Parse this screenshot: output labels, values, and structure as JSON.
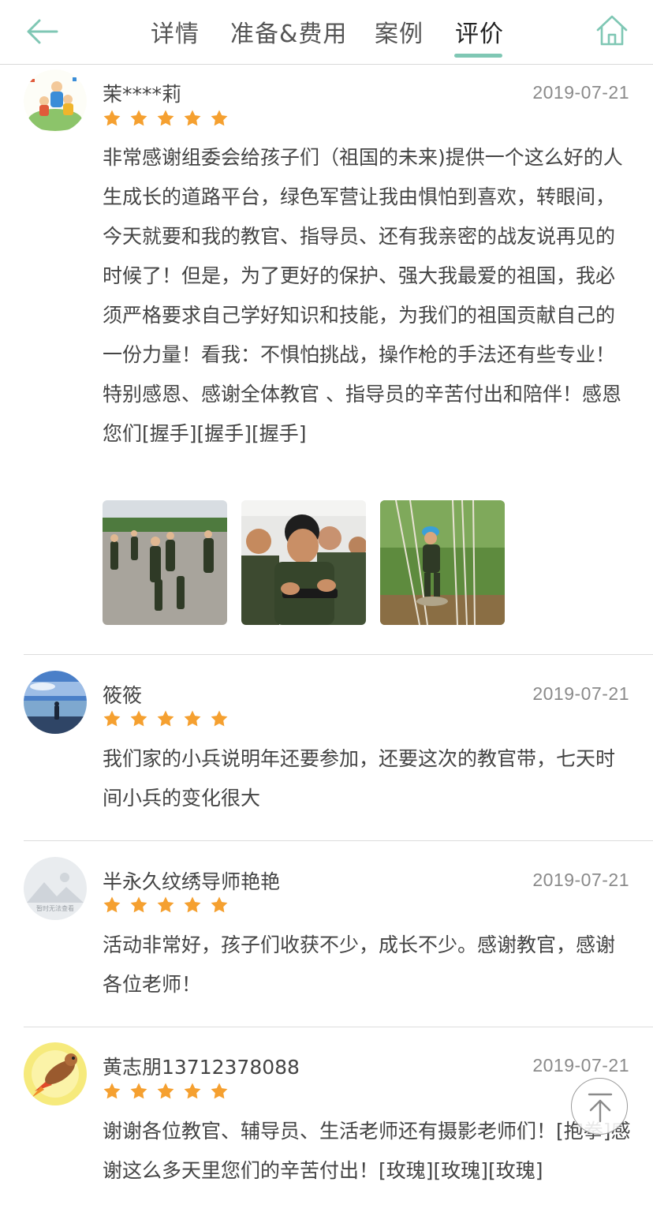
{
  "header": {
    "tabs": [
      {
        "label": "详情"
      },
      {
        "label": "准备&费用"
      },
      {
        "label": "案例"
      },
      {
        "label": "评价"
      }
    ],
    "active_tab": "评价",
    "accent_color": "#7fc7b4",
    "back_icon": "arrow-left-icon",
    "home_icon": "home-icon"
  },
  "star_color": "#f5a030",
  "reviews": [
    {
      "name": "茉****莉",
      "date": "2019-07-21",
      "rating": 5,
      "text": "非常感谢组委会给孩子们（祖国的未来)提供一个这么好的人生成长的道路平台，绿色军营让我由惧怕到喜欢，转眼间，今天就要和我的教官、指导员、还有我亲密的战友说再见的时候了！但是，为了更好的保护、强大我最爱的祖国，我必须严格要求自己学好知识和技能，为我们的祖国贡献自己的一份力量！看我：不惧怕挑战，操作枪的手法还有些专业！特别感恩、感谢全体教官 、指导员的辛苦付出和陪伴！感恩您们[握手][握手][握手]"
    },
    {
      "name": "筱筱",
      "date": "2019-07-21",
      "rating": 5,
      "text": "我们家的小兵说明年还要参加，还要这次的教官带，七天时间小兵的变化很大"
    },
    {
      "name": "半永久纹绣导师艳艳",
      "date": "2019-07-21",
      "rating": 5,
      "text": "活动非常好，孩子们收获不少，成长不少。感谢教官，感谢各位老师！",
      "avatar_caption": "暂时无法查看"
    },
    {
      "name": "黄志朋13712378088",
      "date": "2019-07-21",
      "rating": 5,
      "text": "谢谢各位教官、辅导员、生活老师还有摄影老师们！[抱拳]感谢这么多天里您们的辛苦付出！[玫瑰][玫瑰][玫瑰]"
    }
  ],
  "back_to_top_icon": "arrow-up-to-top-icon"
}
